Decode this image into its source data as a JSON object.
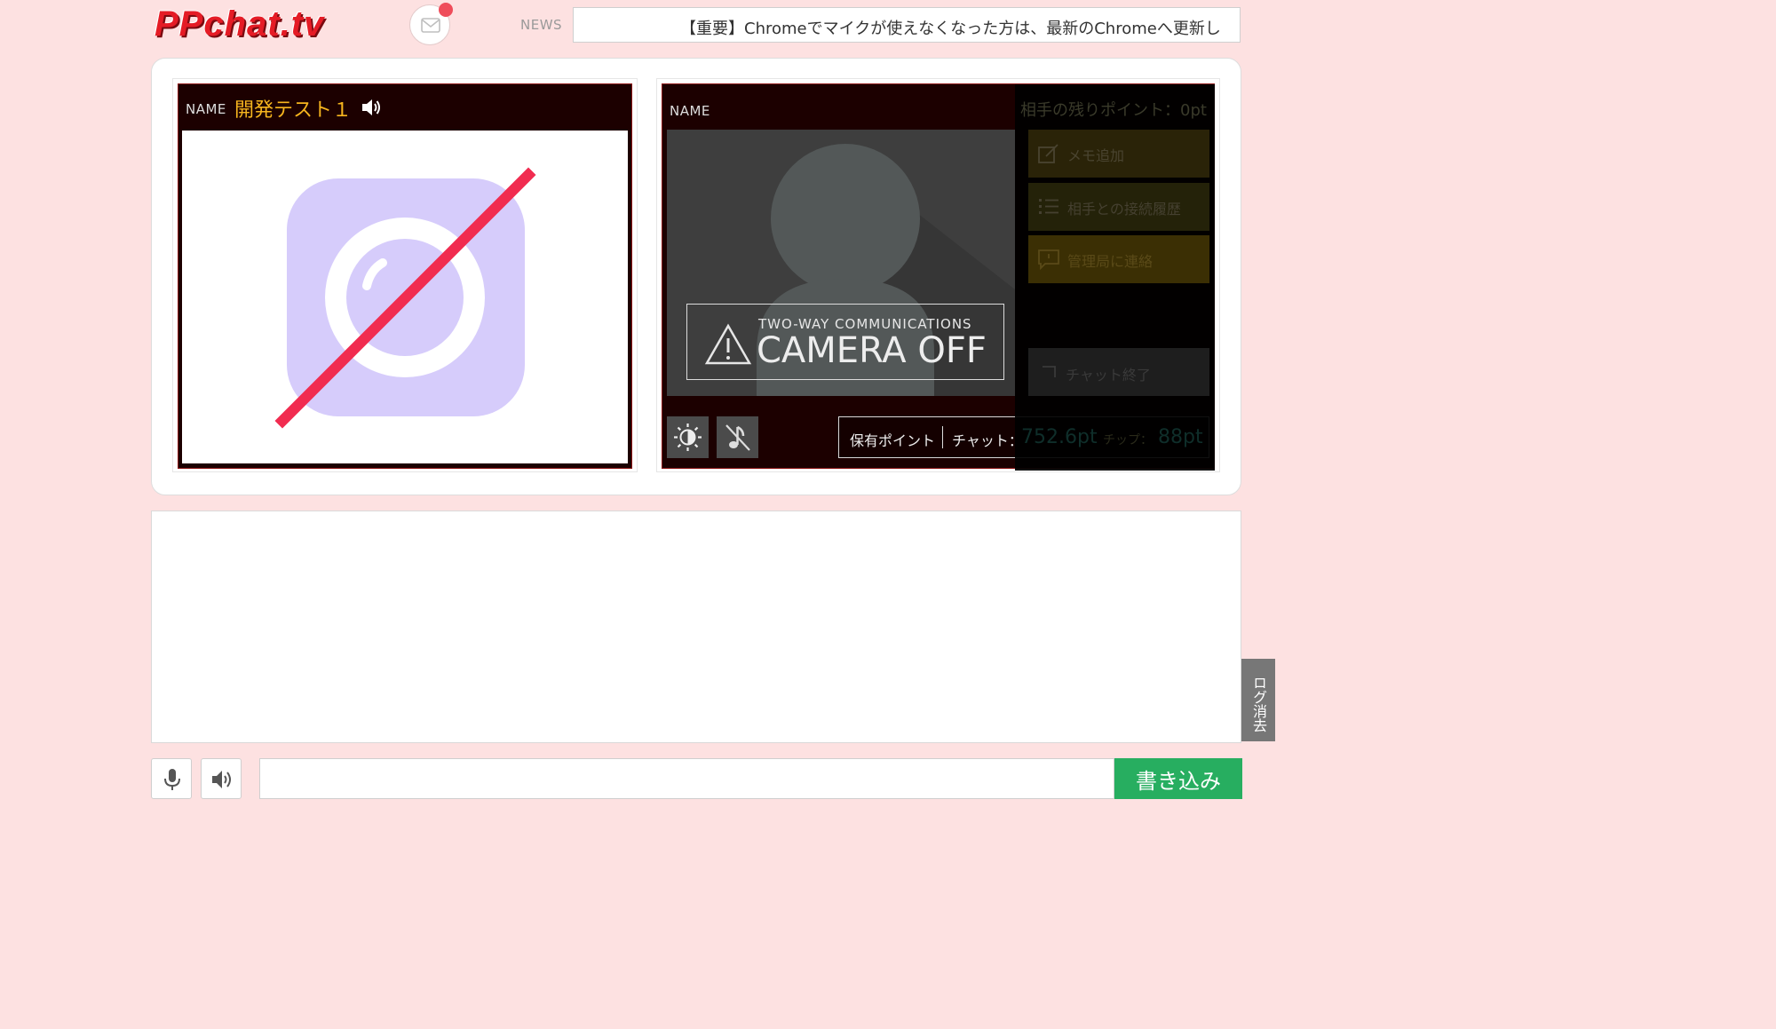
{
  "header": {
    "logo_text": "PPchat.tv",
    "mail_icon": "mail-icon",
    "news_label": "NEWS",
    "news_text": "【重要】Chromeでマイクが使えなくなった方は、最新のChromeへ更新し"
  },
  "self_cam": {
    "name_label": "NAME",
    "name_value": "開発テスト１",
    "speaker_icon": "speaker-icon",
    "video_icon": "camera-off-icon"
  },
  "peer_cam": {
    "name_label": "NAME",
    "camera_off_sub": "TWO-WAY COMMUNICATIONS",
    "camera_off_main": "CAMERA OFF",
    "brightness_icon": "brightness-icon",
    "sound_off_icon": "music-off-icon",
    "points_label": "保有ポイント",
    "chat_label": "チャット：",
    "chat_value": "752.6pt",
    "chip_label": "チップ：",
    "chip_value": "88pt"
  },
  "overlay": {
    "remaining_points": "相手の残りポイント：0pt",
    "buttons": [
      {
        "label": "メモ追加",
        "icon": "memo-icon"
      },
      {
        "label": "相手との接続履歴",
        "icon": "list-icon"
      },
      {
        "label": "管理局に連絡",
        "icon": "chat-bubble-icon"
      }
    ],
    "end_label": "チャット終了"
  },
  "log": {
    "clear_label": "ログ消去"
  },
  "input_bar": {
    "mic_icon": "microphone-icon",
    "volume_icon": "speaker-icon",
    "message_value": "",
    "send_label": "書き込み"
  },
  "colors": {
    "background": "#fde1e1",
    "accent_name": "#f6b51e",
    "send_button": "#27ae60",
    "logo": "#e51b25",
    "notification": "#ef4c5a"
  }
}
